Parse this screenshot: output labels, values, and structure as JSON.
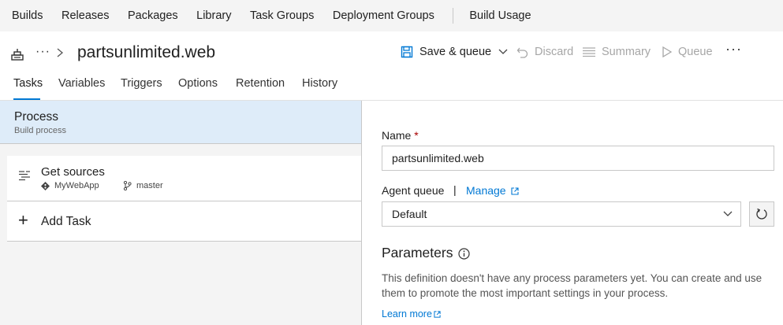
{
  "topnav": {
    "items": [
      "Builds",
      "Releases",
      "Packages",
      "Library",
      "Task Groups",
      "Deployment Groups"
    ],
    "extra": "Build Usage"
  },
  "header": {
    "ellipsis": "···",
    "title": "partsunlimited.web",
    "actions": {
      "save": "Save & queue",
      "discard": "Discard",
      "summary": "Summary",
      "queue": "Queue",
      "more": "···"
    }
  },
  "tabs": [
    "Tasks",
    "Variables",
    "Triggers",
    "Options",
    "Retention",
    "History"
  ],
  "left": {
    "process": {
      "title": "Process",
      "subtitle": "Build process"
    },
    "get_sources": {
      "title": "Get sources",
      "repo": "MyWebApp",
      "branch": "master"
    },
    "add_task": {
      "plus": "+",
      "label": "Add Task"
    }
  },
  "right": {
    "name_label": "Name",
    "required_mark": "*",
    "name_value": "partsunlimited.web",
    "agent_queue_label": "Agent queue",
    "separator": "|",
    "manage_label": "Manage",
    "agent_queue_value": "Default",
    "parameters_title": "Parameters",
    "parameters_desc": "This definition doesn't have any process parameters yet. You can create and use them to promote the most important settings in your process.",
    "learn_more": "Learn more"
  },
  "colors": {
    "accent": "#0078d4",
    "selected_bg": "#deecf9",
    "required": "#a80000"
  }
}
